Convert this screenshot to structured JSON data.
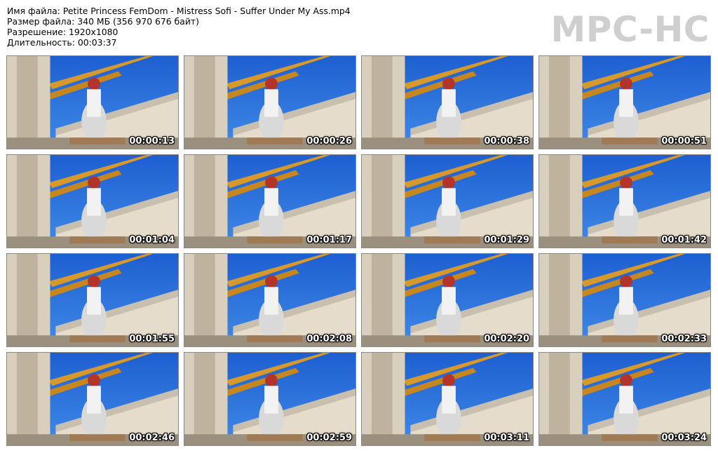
{
  "header": {
    "filename_label": "Имя файла:",
    "filename": "Petite Princess FemDom - Mistress Sofi - Suffer Under My Ass.mp4",
    "filesize_label": "Размер файла:",
    "filesize": "340 МБ (356 970 676 байт)",
    "resolution_label": "Разрешение:",
    "resolution": "1920x1080",
    "duration_label": "Длительность:",
    "duration": "00:03:37"
  },
  "logo": "MPC-HC",
  "thumbnails": [
    {
      "timestamp": "00:00:13"
    },
    {
      "timestamp": "00:00:26"
    },
    {
      "timestamp": "00:00:38"
    },
    {
      "timestamp": "00:00:51"
    },
    {
      "timestamp": "00:01:04"
    },
    {
      "timestamp": "00:01:17"
    },
    {
      "timestamp": "00:01:29"
    },
    {
      "timestamp": "00:01:42"
    },
    {
      "timestamp": "00:01:55"
    },
    {
      "timestamp": "00:02:08"
    },
    {
      "timestamp": "00:02:20"
    },
    {
      "timestamp": "00:02:33"
    },
    {
      "timestamp": "00:02:46"
    },
    {
      "timestamp": "00:02:59"
    },
    {
      "timestamp": "00:03:11"
    },
    {
      "timestamp": "00:03:24"
    }
  ]
}
